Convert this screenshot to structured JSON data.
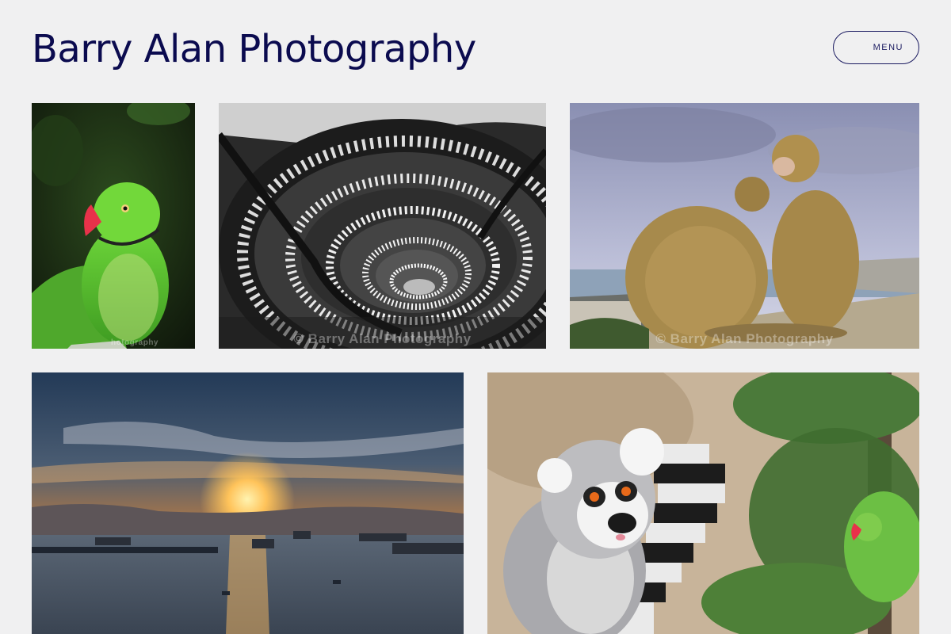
{
  "header": {
    "site_title": "Barry Alan Photography",
    "menu_label": "MENU"
  },
  "gallery": {
    "items": [
      {
        "subject": "green parakeet",
        "watermark": "hotography"
      },
      {
        "subject": "spiral staircase",
        "watermark": "© Barry Alan Photography"
      },
      {
        "subject": "barbary macaques",
        "watermark": "© Barry Alan Photography"
      },
      {
        "subject": "sunset over bay",
        "watermark": ""
      },
      {
        "subject": "ring-tailed lemur",
        "watermark": ""
      }
    ]
  },
  "colors": {
    "background": "#f0f0f1",
    "title": "#0b0b4f",
    "menu_border": "#1a1a60"
  }
}
